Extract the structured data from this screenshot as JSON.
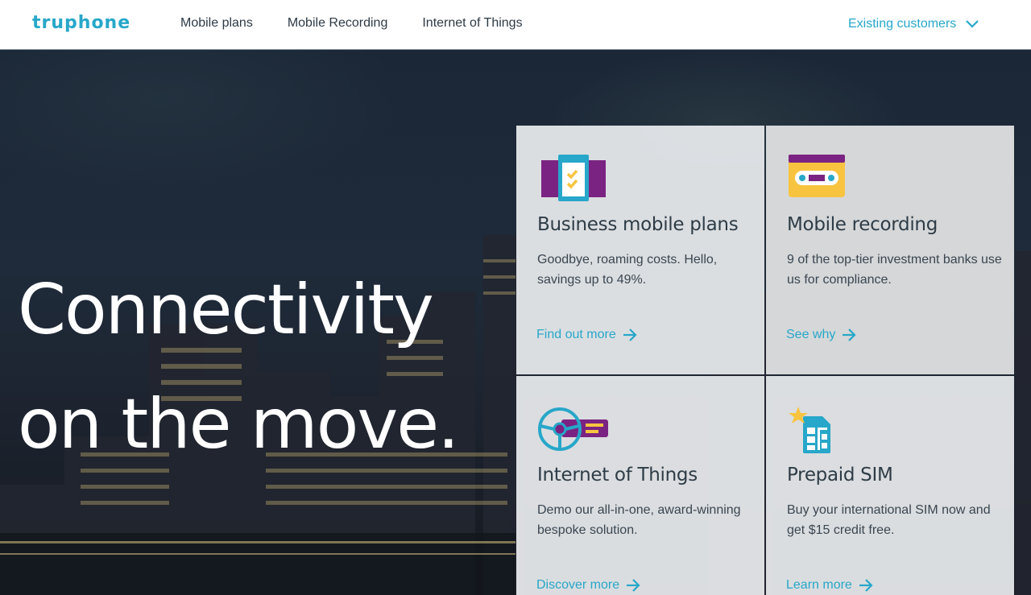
{
  "header": {
    "logo": "truphone",
    "nav": [
      "Mobile plans",
      "Mobile Recording",
      "Internet of Things"
    ],
    "existing_customers": "Existing customers",
    "dropdown_icon": "chevron-down-icon"
  },
  "hero": {
    "headline_line1": "Connectivity",
    "headline_line2": "on the move."
  },
  "cards": [
    {
      "icon": "phone-checklist-icon",
      "title": "Business mobile plans",
      "description": "Goodbye, roaming costs. Hello, savings up to 49%.",
      "cta": "Find out more"
    },
    {
      "icon": "cassette-tape-icon",
      "title": "Mobile recording",
      "description": "9 of the top-tier investment banks use us for compliance.",
      "cta": "See why"
    },
    {
      "icon": "steering-wheel-icon",
      "title": "Internet of Things",
      "description": "Demo our all-in-one, award-winning bespoke solution.",
      "cta": "Discover more"
    },
    {
      "icon": "sim-card-star-icon",
      "title": "Prepaid SIM",
      "description": "Buy your international SIM now and get $15 credit free.",
      "cta": "Learn more"
    }
  ],
  "colors": {
    "brand": "#27a7c9",
    "purple": "#7b2382",
    "yellow": "#f8c440",
    "text_dark": "#2e3c46"
  }
}
